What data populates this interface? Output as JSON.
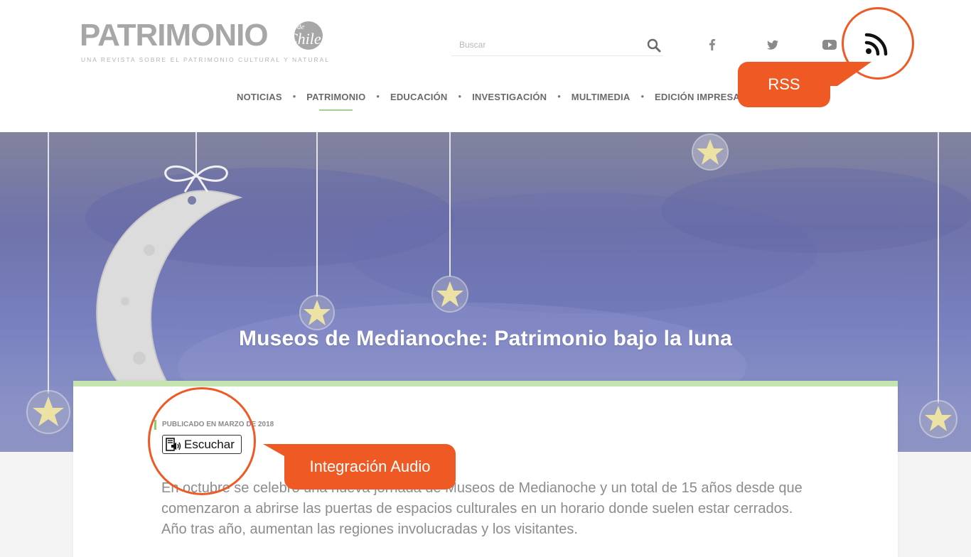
{
  "site": {
    "logo_word": "PATRIMONIO",
    "logo_de": "de",
    "logo_chile": "Chile",
    "logo_tagline": "UNA REVISTA SOBRE EL PATRIMONIO CULTURAL Y NATURAL"
  },
  "search": {
    "placeholder": "Buscar",
    "value": ""
  },
  "social": [
    "facebook-icon",
    "twitter-icon",
    "youtube-icon",
    "rss-icon"
  ],
  "nav": {
    "items": [
      "NOTICIAS",
      "PATRIMONIO",
      "EDUCACIÓN",
      "INVESTIGACIÓN",
      "MULTIMEDIA",
      "EDICIÓN IMPRESA"
    ],
    "active": "PATRIMONIO"
  },
  "hero": {
    "title": "Museos de Medianoche: Patrimonio bajo la luna"
  },
  "article": {
    "published": "PUBLICADO EN MARZO DE 2018",
    "listen_label": "Escuchar",
    "body": "En octubre se celebró una nueva jornada de Museos de Medianoche y un total de 15 años desde que comenzaron a abrirse las puertas de espacios culturales en un horario donde suelen estar cerrados. Año tras año, aumentan las regiones involucradas y los visitantes."
  },
  "annotations": {
    "rss_label": "RSS",
    "audio_label": "Integración Audio",
    "accent_color": "#ef5a24"
  },
  "colors": {
    "nav_active_underline": "#a6cf8f",
    "card_top_border": "#c6e4b0",
    "hero_sky": "#7880c0"
  }
}
